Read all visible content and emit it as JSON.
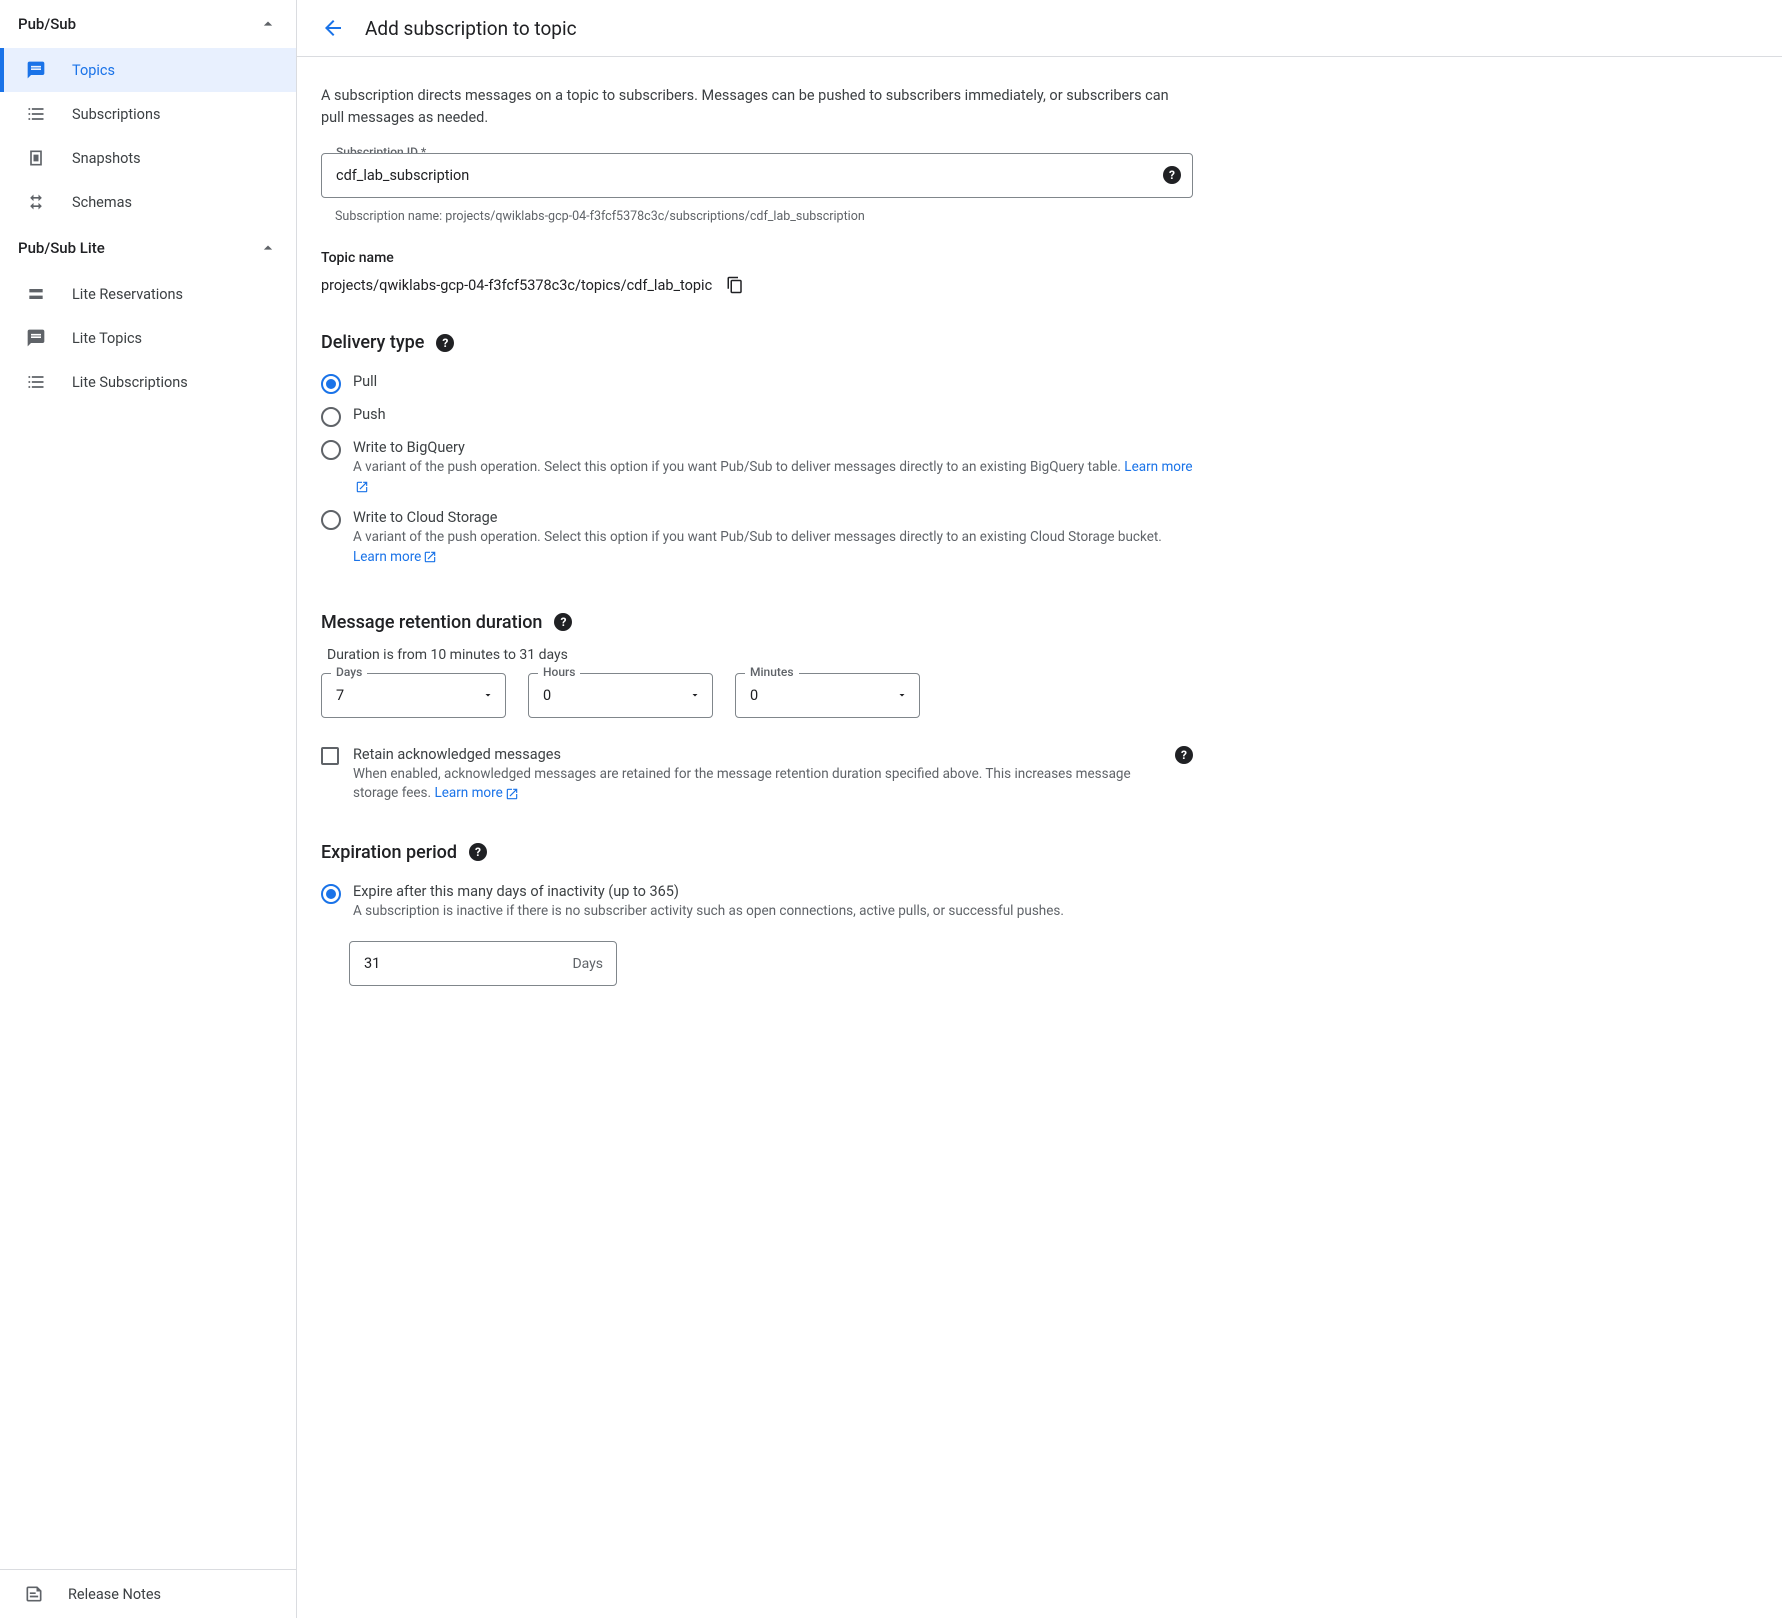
{
  "sidebar": {
    "section1": "Pub/Sub",
    "items1": [
      {
        "label": "Topics"
      },
      {
        "label": "Subscriptions"
      },
      {
        "label": "Snapshots"
      },
      {
        "label": "Schemas"
      }
    ],
    "section2": "Pub/Sub Lite",
    "items2": [
      {
        "label": "Lite Reservations"
      },
      {
        "label": "Lite Topics"
      },
      {
        "label": "Lite Subscriptions"
      }
    ],
    "release_notes": "Release Notes"
  },
  "header": {
    "title": "Add subscription to topic"
  },
  "description": "A subscription directs messages on a topic to subscribers. Messages can be pushed to subscribers immediately, or subscribers can pull messages as needed.",
  "subscription_id": {
    "label": "Subscription ID *",
    "value": "cdf_lab_subscription",
    "helper": "Subscription name: projects/qwiklabs-gcp-04-f3fcf5378c3c/subscriptions/cdf_lab_subscription"
  },
  "topic": {
    "label": "Topic name",
    "value": "projects/qwiklabs-gcp-04-f3fcf5378c3c/topics/cdf_lab_topic"
  },
  "delivery": {
    "heading": "Delivery type",
    "options": [
      {
        "label": "Pull",
        "desc": ""
      },
      {
        "label": "Push",
        "desc": ""
      },
      {
        "label": "Write to BigQuery",
        "desc": "A variant of the push operation. Select this option if you want Pub/Sub to deliver messages directly to an existing BigQuery table.",
        "learn": "Learn more"
      },
      {
        "label": "Write to Cloud Storage",
        "desc": "A variant of the push operation. Select this option if you want Pub/Sub to deliver messages directly to an existing Cloud Storage bucket.",
        "learn": "Learn more"
      }
    ]
  },
  "retention": {
    "heading": "Message retention duration",
    "hint": "Duration is from 10 minutes to 31 days",
    "days_label": "Days",
    "days_value": "7",
    "hours_label": "Hours",
    "hours_value": "0",
    "minutes_label": "Minutes",
    "minutes_value": "0",
    "retain_label": "Retain acknowledged messages",
    "retain_desc": "When enabled, acknowledged messages are retained for the message retention duration specified above. This increases message storage fees.",
    "retain_learn": "Learn more"
  },
  "expiration": {
    "heading": "Expiration period",
    "option_label": "Expire after this many days of inactivity (up to 365)",
    "option_desc": "A subscription is inactive if there is no subscriber activity such as open connections, active pulls, or successful pushes.",
    "value": "31",
    "suffix": "Days"
  }
}
